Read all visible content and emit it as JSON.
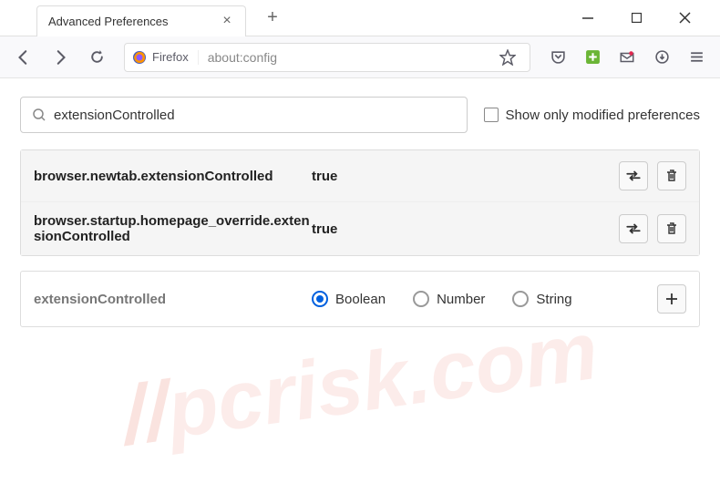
{
  "tab": {
    "title": "Advanced Preferences"
  },
  "urlbar": {
    "identity": "Firefox",
    "url": "about:config"
  },
  "search": {
    "value": "extensionControlled",
    "checkbox_label": "Show only modified preferences"
  },
  "prefs": [
    {
      "name": "browser.newtab.extensionControlled",
      "value": "true"
    },
    {
      "name": "browser.startup.homepage_override.extensionControlled",
      "value": "true"
    }
  ],
  "add_row": {
    "name": "extensionControlled",
    "types": [
      "Boolean",
      "Number",
      "String"
    ],
    "selected": "Boolean"
  },
  "watermark": "pcrisk.com"
}
